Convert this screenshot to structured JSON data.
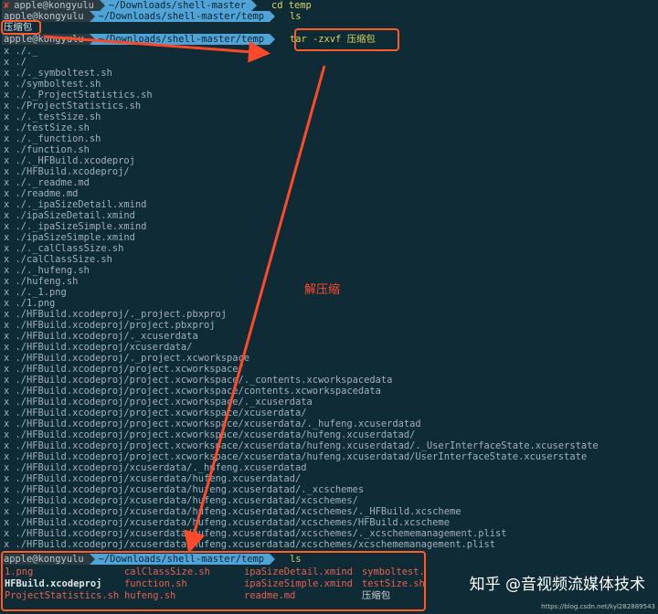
{
  "prompt": {
    "user": "apple@kongyulu",
    "path": "~/Downloads/shell-master",
    "path_temp": "~/Downloads/shell-master/temp",
    "x_mark": "✘"
  },
  "commands": {
    "cd": "cd temp",
    "ls": "ls",
    "tar": "tar -zxvf 压缩包"
  },
  "first_ls_output": "压缩包",
  "tar_output": [
    "x ./._",
    "x ./",
    "x ./._symboltest.sh",
    "x ./symboltest.sh",
    "x ./._ProjectStatistics.sh",
    "x ./ProjectStatistics.sh",
    "x ./._testSize.sh",
    "x ./testSize.sh",
    "x ./._function.sh",
    "x ./function.sh",
    "x ./._HFBuild.xcodeproj",
    "x ./HFBuild.xcodeproj/",
    "x ./._readme.md",
    "x ./readme.md",
    "x ./._ipaSizeDetail.xmind",
    "x ./ipaSizeDetail.xmind",
    "x ./._ipaSizeSimple.xmind",
    "x ./ipaSizeSimple.xmind",
    "x ./._calClassSize.sh",
    "x ./calClassSize.sh",
    "x ./._hufeng.sh",
    "x ./hufeng.sh",
    "x ./._1.png",
    "x ./1.png",
    "x ./HFBuild.xcodeproj/._project.pbxproj",
    "x ./HFBuild.xcodeproj/project.pbxproj",
    "x ./HFBuild.xcodeproj/._xcuserdata",
    "x ./HFBuild.xcodeproj/xcuserdata/",
    "x ./HFBuild.xcodeproj/._project.xcworkspace",
    "x ./HFBuild.xcodeproj/project.xcworkspace/",
    "x ./HFBuild.xcodeproj/project.xcworkspace/._contents.xcworkspacedata",
    "x ./HFBuild.xcodeproj/project.xcworkspace/contents.xcworkspacedata",
    "x ./HFBuild.xcodeproj/project.xcworkspace/._xcuserdata",
    "x ./HFBuild.xcodeproj/project.xcworkspace/xcuserdata/",
    "x ./HFBuild.xcodeproj/project.xcworkspace/xcuserdata/._hufeng.xcuserdatad",
    "x ./HFBuild.xcodeproj/project.xcworkspace/xcuserdata/hufeng.xcuserdatad/",
    "x ./HFBuild.xcodeproj/project.xcworkspace/xcuserdata/hufeng.xcuserdatad/._UserInterfaceState.xcuserstate",
    "x ./HFBuild.xcodeproj/project.xcworkspace/xcuserdata/hufeng.xcuserdatad/UserInterfaceState.xcuserstate",
    "x ./HFBuild.xcodeproj/xcuserdata/._hufeng.xcuserdatad",
    "x ./HFBuild.xcodeproj/xcuserdata/hufeng.xcuserdatad/",
    "x ./HFBuild.xcodeproj/xcuserdata/hufeng.xcuserdatad/._xcschemes",
    "x ./HFBuild.xcodeproj/xcuserdata/hufeng.xcuserdatad/xcschemes/",
    "x ./HFBuild.xcodeproj/xcuserdata/hufeng.xcuserdatad/xcschemes/._HFBuild.xcscheme",
    "x ./HFBuild.xcodeproj/xcuserdata/hufeng.xcuserdatad/xcschemes/HFBuild.xcscheme",
    "x ./HFBuild.xcodeproj/xcuserdata/hufeng.xcuserdatad/xcschemes/._xcschememanagement.plist",
    "x ./HFBuild.xcodeproj/xcuserdata/hufeng.xcuserdatad/xcschemes/xcschememanagement.plist"
  ],
  "final_ls": {
    "row1": [
      "1.png",
      "calClassSize.sh",
      "ipaSizeDetail.xmind",
      "symboltest."
    ],
    "row2": [
      "HFBuild.xcodeproj",
      "function.sh",
      "ipaSizeSimple.xmind",
      "testSize.sh"
    ],
    "row3": [
      "ProjectStatistics.sh",
      "hufeng.sh",
      "readme.md",
      "压缩包"
    ]
  },
  "annotation": "解压缩",
  "watermark": "知乎 @音视频流媒体技术",
  "small_watermark": "https://blog.csdn.net/kyl282889543",
  "colors": {
    "background": "#0f2b36",
    "annotation": "#ff4a2a",
    "path_segment": "#4fa3d6",
    "command": "#d6d45e"
  }
}
